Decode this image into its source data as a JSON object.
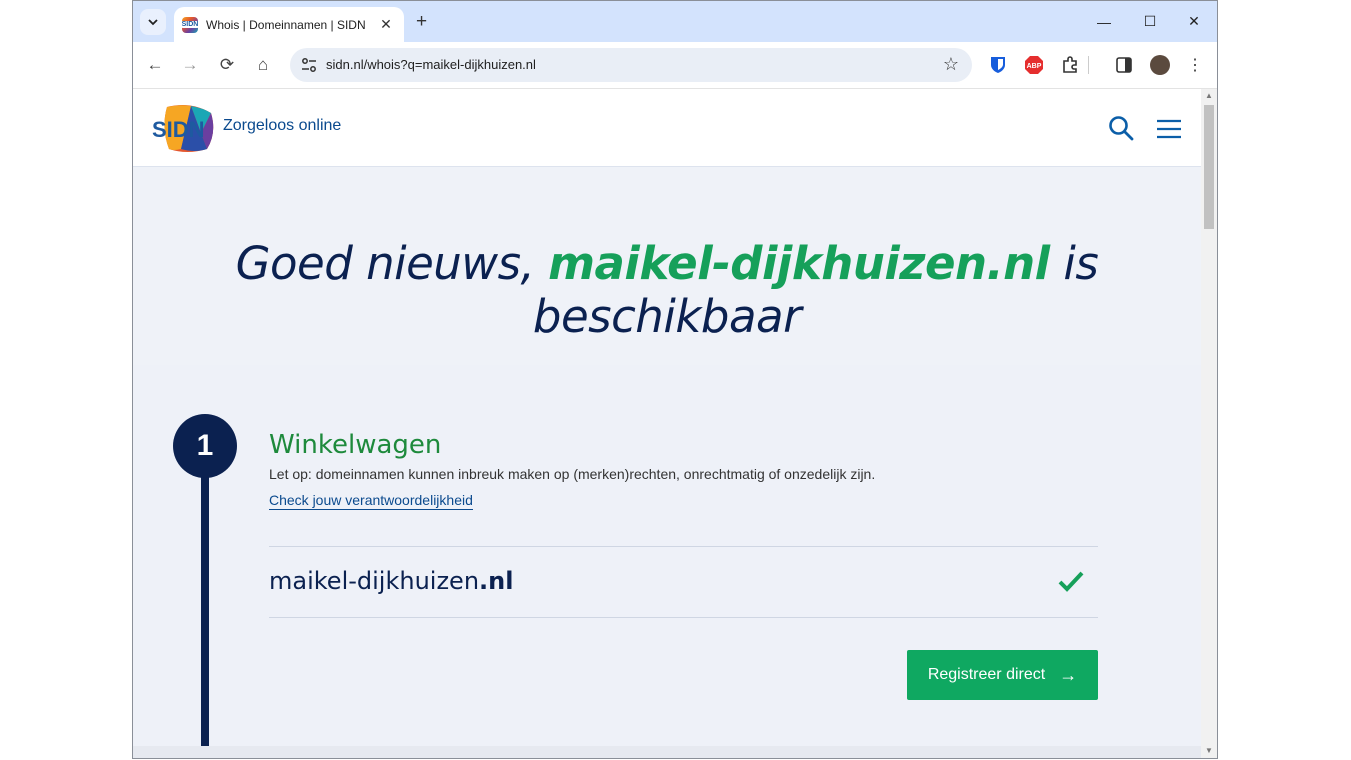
{
  "browser": {
    "tab_title": "Whois | Domeinnamen | SIDN",
    "favicon_text": "SIDN",
    "tab_close": "✕",
    "new_tab": "+",
    "url": "sidn.nl/whois?q=maikel-dijkhuizen.nl",
    "window_controls": {
      "minimize": "—",
      "maximize": "☐",
      "close": "✕"
    },
    "nav": {
      "back": "←",
      "forward": "→",
      "reload": "⟳",
      "home": "⌂"
    },
    "extensions": [
      "bitwarden-icon",
      "adblock-plus-icon",
      "puzzle-icon",
      "side-panel-icon",
      "profile-avatar"
    ],
    "abp_label": "ABP"
  },
  "site": {
    "logo_text": "SIDN",
    "tagline": "Zorgeloos online"
  },
  "hero": {
    "prefix": "Goed nieuws, ",
    "domain": "maikel-dijkhuizen.nl",
    "suffix": " is beschikbaar"
  },
  "step": {
    "number": "1",
    "title": "Winkelwagen",
    "warning": "Let op: domeinnamen kunnen inbreuk maken op (merken)rechten, onrechtmatig of onzedelijk zijn.",
    "link": "Check jouw verantwoordelijkheid",
    "domain_base": "maikel-dijkhuizen",
    "domain_tld": ".nl",
    "button": "Registreer direct",
    "button_arrow": "→"
  },
  "colors": {
    "navy": "#0b2150",
    "green": "#16a05a",
    "button_green": "#0fa861",
    "title_green": "#1e8a3c"
  }
}
